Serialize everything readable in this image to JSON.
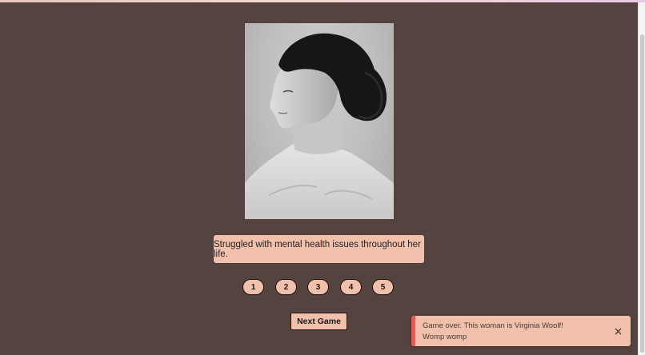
{
  "game": {
    "portrait_icon": "woman-profile-photo",
    "clue": "Struggled with mental health issues throughout her life.",
    "guess_buttons": [
      "1",
      "2",
      "3",
      "4",
      "5"
    ],
    "next_game_label": "Next Game"
  },
  "toast": {
    "line1": "Game over. This woman is Virginia Woolf!",
    "line2": "Womp womp",
    "close_icon": "close-icon"
  },
  "colors": {
    "background": "#54433f",
    "accent": "#f2c0ab",
    "toast_stripe": "#e25d52"
  }
}
